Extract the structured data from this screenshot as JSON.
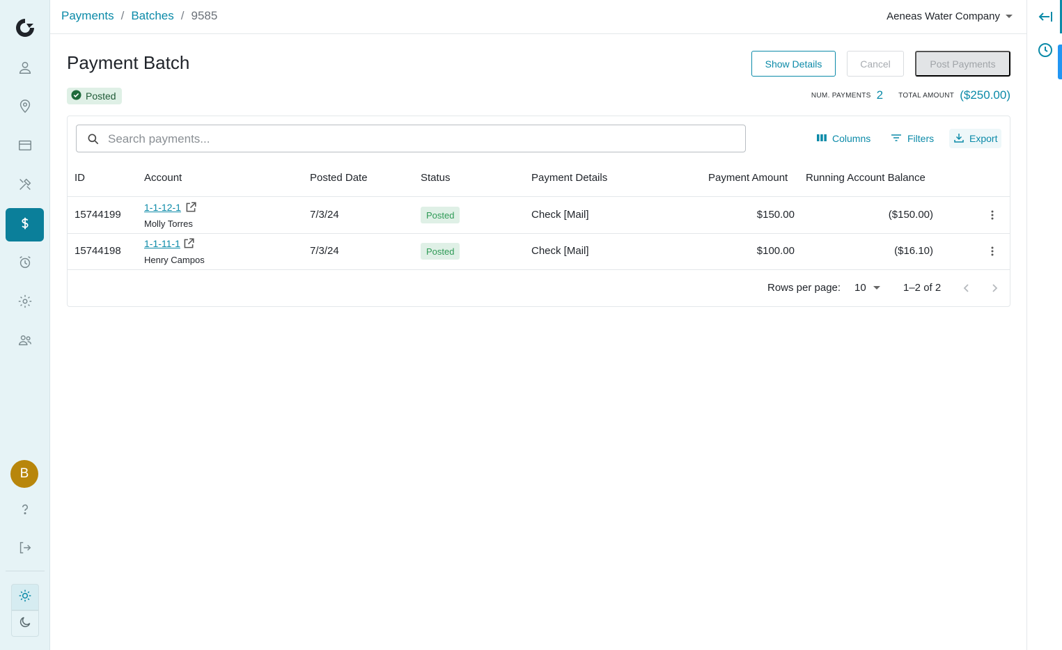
{
  "breadcrumb": {
    "items": [
      "Payments",
      "Batches"
    ],
    "separator": "/",
    "current": "9585"
  },
  "company": {
    "name": "Aeneas Water Company"
  },
  "page": {
    "title": "Payment Batch",
    "status": "Posted"
  },
  "actions": {
    "show_details": "Show Details",
    "cancel": "Cancel",
    "post_payments": "Post Payments"
  },
  "summary": {
    "num_payments_label": "NUM. PAYMENTS",
    "num_payments": "2",
    "total_amount_label": "TOTAL AMOUNT",
    "total_amount": "($250.00)"
  },
  "search": {
    "placeholder": "Search payments..."
  },
  "toolbar": {
    "columns": "Columns",
    "filters": "Filters",
    "export": "Export"
  },
  "table": {
    "columns": [
      "ID",
      "Account",
      "Posted Date",
      "Status",
      "Payment Details",
      "Payment Amount",
      "Running Account Balance"
    ],
    "rows": [
      {
        "id": "15744199",
        "account": "1-1-12-1",
        "name": "Molly Torres",
        "date": "7/3/24",
        "status": "Posted",
        "details": "Check [Mail]",
        "amount": "$150.00",
        "balance": "($150.00)"
      },
      {
        "id": "15744198",
        "account": "1-1-11-1",
        "name": "Henry Campos",
        "date": "7/3/24",
        "status": "Posted",
        "details": "Check [Mail]",
        "amount": "$100.00",
        "balance": "($16.10)"
      }
    ]
  },
  "pagination": {
    "rows_per_page_label": "Rows per page:",
    "rows_per_page": "10",
    "range": "1–2 of 2"
  },
  "user": {
    "initial": "B"
  },
  "colors": {
    "accent": "#0b8aa8",
    "sidebar_bg": "#e6f3f6",
    "active_nav": "#0b7f9a",
    "success_bg": "#dff0e6",
    "avatar": "#b8860b"
  },
  "icons": {
    "sidebar": [
      "person-icon",
      "location-pin-icon",
      "credit-card-icon",
      "tools-icon",
      "dollar-icon",
      "alarm-clock-icon",
      "gear-icon",
      "people-icon"
    ],
    "bottom": [
      "help-icon",
      "logout-icon",
      "sun-icon",
      "moon-icon"
    ],
    "rail": [
      "collapse-left-icon",
      "history-clock-icon"
    ]
  }
}
